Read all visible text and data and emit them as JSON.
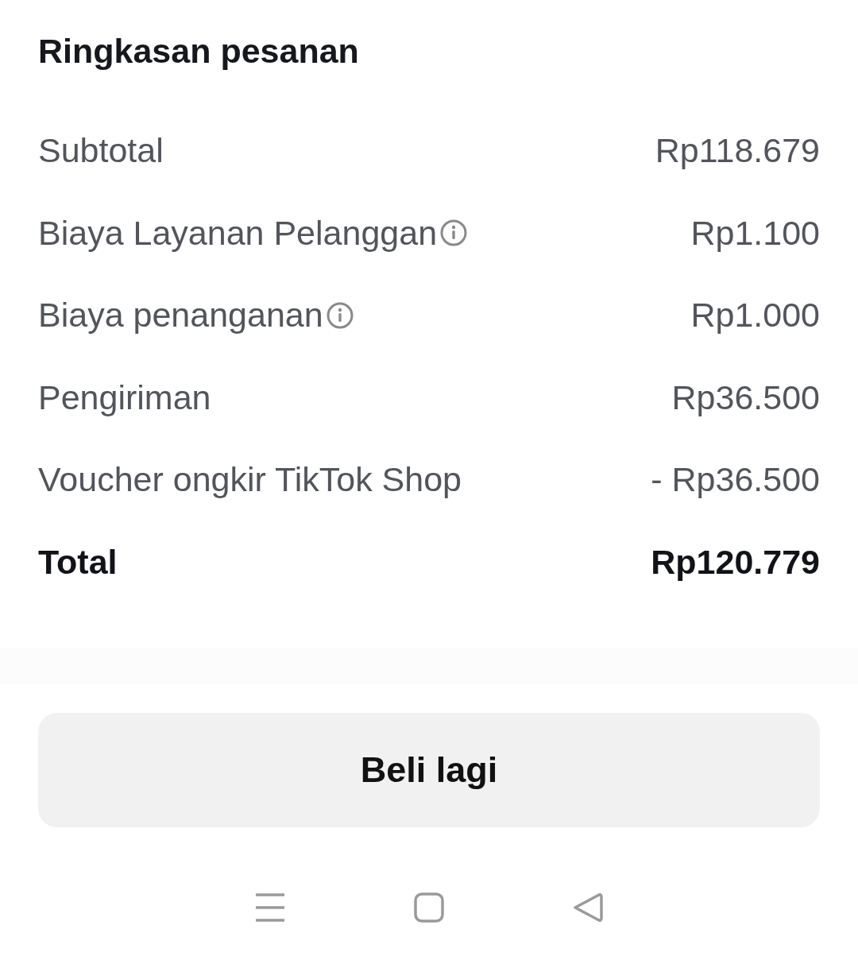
{
  "title": "Ringkasan pesanan",
  "rows": [
    {
      "label": "Subtotal",
      "value": "Rp118.679",
      "info": false,
      "kind": "line"
    },
    {
      "label": "Biaya Layanan Pelanggan",
      "value": "Rp1.100",
      "info": true,
      "kind": "line"
    },
    {
      "label": "Biaya penanganan",
      "value": "Rp1.000",
      "info": true,
      "kind": "line"
    },
    {
      "label": "Pengiriman",
      "value": "Rp36.500",
      "info": false,
      "kind": "line"
    },
    {
      "label": "Voucher ongkir TikTok Shop",
      "value": "- Rp36.500",
      "info": false,
      "kind": "line"
    },
    {
      "label": "Total",
      "value": "Rp120.779",
      "info": false,
      "kind": "total"
    }
  ],
  "button": "Beli lagi"
}
